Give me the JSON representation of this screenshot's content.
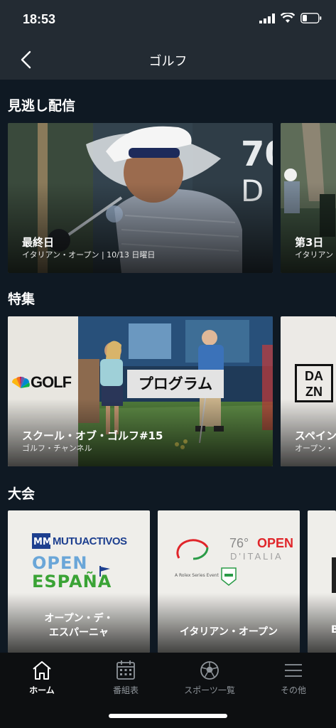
{
  "status": {
    "time": "18:53"
  },
  "header": {
    "title": "ゴルフ"
  },
  "sections": {
    "replay": "見逃し配信",
    "featured": "特集",
    "tournaments": "大会"
  },
  "replay_cards": [
    {
      "title": "最終日",
      "subtitle": "イタリアン・オープン | 10/13 日曜日"
    },
    {
      "title": "第3日",
      "subtitle": "イタリアン"
    }
  ],
  "featured_cards": [
    {
      "title": "スクール・オブ・ゴルフ#15",
      "subtitle": "ゴルフ・チャンネル",
      "logo": "GOLF",
      "badge": "プログラム"
    },
    {
      "title": "スペイン",
      "subtitle": "オープン・",
      "logo_top": "DA",
      "logo_bottom": "ZN"
    }
  ],
  "tournament_cards": [
    {
      "title_line1": "オープン・デ・",
      "title_line2": "エスパーニャ",
      "logo_sponsor": "MUTUACTIVOS",
      "logo_open": "OPEN",
      "logo_espana": "ESPAÑA"
    },
    {
      "title": "イタリアン・オープン",
      "logo_edition": "76°",
      "logo_open": "OPEN",
      "logo_country": "D'ITALIA",
      "logo_series": "A Rolex Series Event"
    },
    {
      "title": "B"
    }
  ],
  "tabs": [
    {
      "label": "ホーム",
      "icon": "home-icon",
      "active": true
    },
    {
      "label": "番組表",
      "icon": "calendar-icon",
      "active": false
    },
    {
      "label": "スポーツ一覧",
      "icon": "ball-icon",
      "active": false
    },
    {
      "label": "その他",
      "icon": "menu-icon",
      "active": false
    }
  ],
  "colors": {
    "background": "#0f1923",
    "header": "#232b33",
    "tab_bar": "#0d0f11",
    "italia_red": "#e0252a",
    "espana_blue": "#1d3f8f",
    "espana_green": "#3aa335"
  }
}
